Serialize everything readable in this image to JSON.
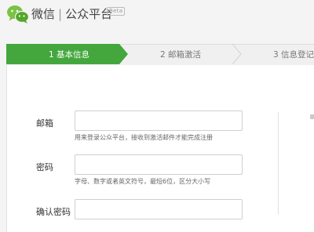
{
  "header": {
    "app_name": "微信",
    "separator": "|",
    "platform_name": "公众平台",
    "beta_badge": "Beta"
  },
  "steps": [
    {
      "label": "1 基本信息",
      "active": true
    },
    {
      "label": "2 邮箱激活",
      "active": false
    },
    {
      "label": "3 信息登记",
      "active": false
    }
  ],
  "form": {
    "email_label": "邮箱",
    "email_value": "",
    "email_hint": "用来登录公众平台，接收到激活邮件才能完成注册",
    "password_label": "密码",
    "password_value": "",
    "password_hint": "字母、数字或者英文符号，最短6位，区分大小写",
    "confirm_label": "确认密码",
    "confirm_value": ""
  },
  "colors": {
    "accent_green": "#43a73d",
    "text": "#333333",
    "hint": "#666666"
  }
}
